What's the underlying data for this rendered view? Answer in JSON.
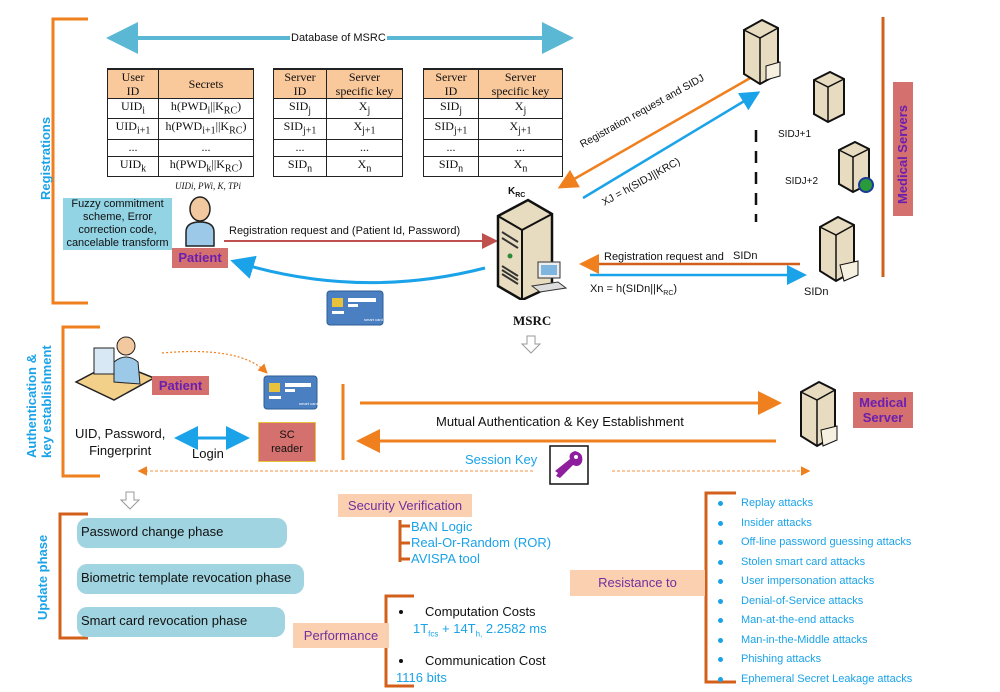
{
  "sections": {
    "registrations": "Registrations",
    "auth": [
      "Authentication &",
      "key establishment"
    ],
    "update": "Update phase"
  },
  "database": {
    "title": "Database of MSRC",
    "user_table": {
      "headers": [
        "User ID",
        "Secrets"
      ],
      "rows": [
        [
          "UIDi",
          "h(PWDi||KRC)"
        ],
        [
          "UIDi+1",
          "h(PWDi+1||KRC)"
        ],
        [
          "...",
          "..."
        ],
        [
          "UIDk",
          "h(PWDk||KRC)"
        ]
      ]
    },
    "server_tables": [
      {
        "headers": [
          "Server ID",
          "Server specific key"
        ],
        "rows": [
          [
            "SIDj",
            "Xj"
          ],
          [
            "SIDj+1",
            "Xj+1"
          ],
          [
            "...",
            "..."
          ],
          [
            "SIDn",
            "Xn"
          ]
        ]
      },
      {
        "headers": [
          "Server ID",
          "Server specific key"
        ],
        "rows": [
          [
            "SIDj",
            "Xj"
          ],
          [
            "SIDj+1",
            "Xj+1"
          ],
          [
            "...",
            "..."
          ],
          [
            "SIDn",
            "Xn"
          ]
        ]
      }
    ]
  },
  "registration": {
    "patient_params": "UIDi, PWi, K, TPi",
    "fuzzy_box": [
      "Fuzzy commitment",
      "scheme, Error",
      "correction code,",
      "cancelable transform"
    ],
    "patient_label": "Patient",
    "patient_request": "Registration request and (Patient Id, Password)",
    "krc": "KRC",
    "msrc_label": "MSRC",
    "server_j_request": "Registration request and   SIDJ",
    "server_j_response": "XJ = h(SIDJ||KRC)",
    "sid_j1": "SIDJ+1",
    "sid_j2": "SIDJ+2",
    "server_n_request_a": "Registration request and",
    "server_n_request_b": "SIDn",
    "server_n_response": "Xn = h(SIDn||KRC)",
    "sid_n": "SIDn",
    "medical_servers": "Medical Servers",
    "smart_card_label": "smart card"
  },
  "authentication": {
    "patient_label": "Patient",
    "credentials": [
      "UID, Password,",
      "Fingerprint"
    ],
    "login": "Login",
    "sc_reader": [
      "SC",
      "reader"
    ],
    "mutual": "Mutual Authentication & Key Establishment",
    "session_key": "Session Key",
    "medical_server": [
      "Medical",
      "Server"
    ],
    "smart_card_label": "smart card"
  },
  "update": {
    "phases": [
      "Password change phase",
      "Biometric template revocation phase",
      "Smart card revocation phase"
    ]
  },
  "security_verification": {
    "title": "Security Verification",
    "items": [
      "BAN Logic",
      "Real-Or-Random (ROR)",
      "AVISPA tool"
    ]
  },
  "performance": {
    "title": "Performance",
    "computation_title": "Computation Costs",
    "computation_value": "1Tfcs + 14Th, 2.2582 ms",
    "communication_title": "Communication Cost",
    "communication_value": "1116 bits"
  },
  "resistance": {
    "title": "Resistance to",
    "items": [
      "Replay attacks",
      "Insider attacks",
      "Off-line password guessing attacks",
      "Stolen smart card attacks",
      "User impersonation attacks",
      "Denial-of-Service attacks",
      "Man-at-the-end attacks",
      "Man-in-the-Middle attacks",
      "Phishing attacks",
      "Ephemeral Secret Leakage attacks"
    ]
  },
  "colors": {
    "orange": "#f07f1e",
    "dark_orange": "#d2601a",
    "blue": "#1aa3e8",
    "teal_arrow": "#5bb8d4",
    "red_arrow": "#c0504d",
    "patient_tag": "#d4706e",
    "purple": "#7030a0",
    "peach": "#fad0b0"
  }
}
